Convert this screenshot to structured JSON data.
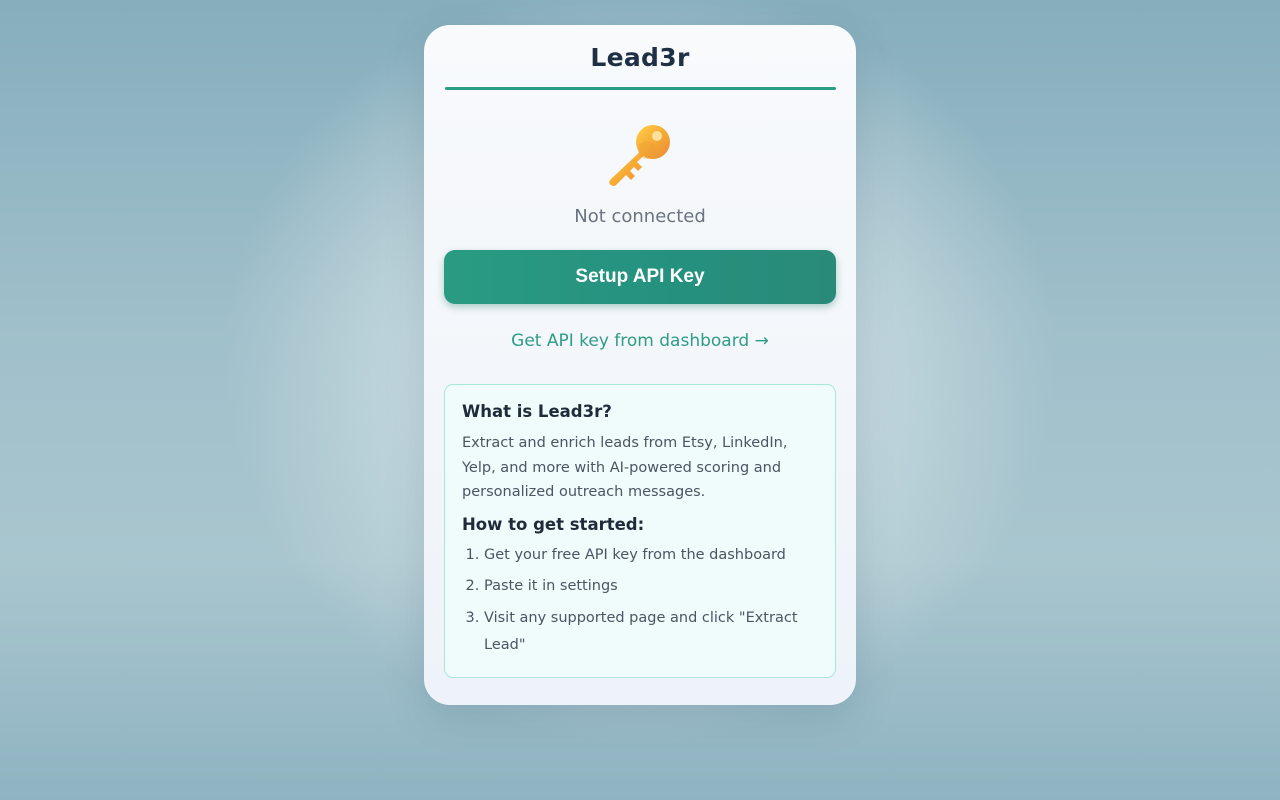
{
  "app": {
    "title": "Lead3r"
  },
  "status": {
    "icon": "key-icon",
    "text": "Not connected"
  },
  "actions": {
    "setup_label": "Setup API Key",
    "dashboard_link": "Get API key from dashboard →"
  },
  "info": {
    "heading": "What is Lead3r?",
    "description": "Extract and enrich leads from Etsy, LinkedIn, Yelp, and more with AI-powered scoring and personalized outreach messages.",
    "steps_heading": "How to get started:",
    "steps": [
      "Get your free API key from the dashboard",
      "Paste it in settings",
      "Visit any supported page and click \"Extract Lead\""
    ]
  },
  "colors": {
    "accent": "#2a9d86",
    "title": "#1f2f44",
    "info_border": "#a8e8da",
    "key": "#f5a833"
  }
}
